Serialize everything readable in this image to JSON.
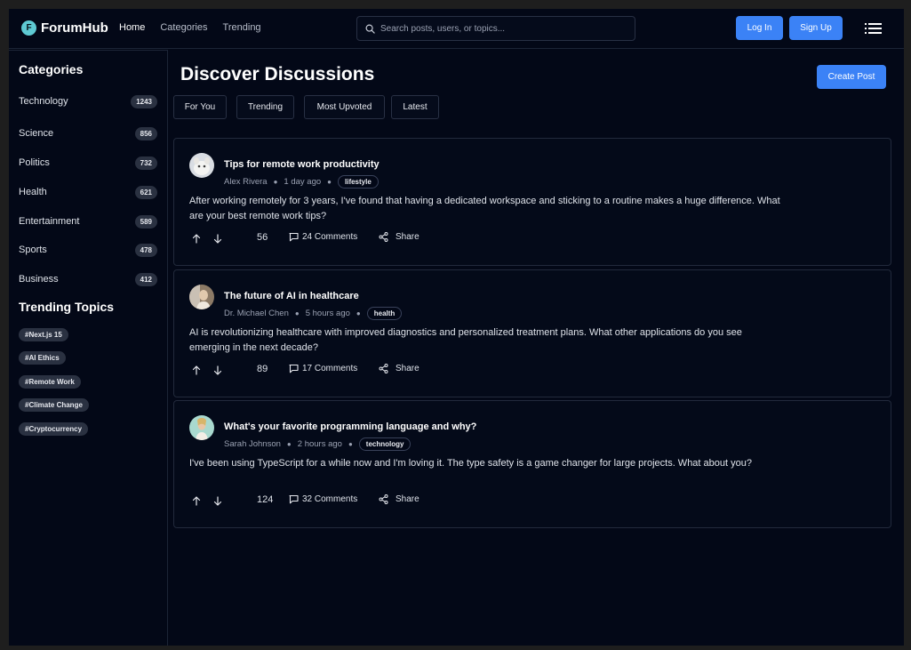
{
  "app": {
    "logo_letter": "F",
    "name": "ForumHub",
    "accent": "#3b82f6",
    "logo_color": "#5ec9d3",
    "background": "#030817"
  },
  "nav": {
    "home": "Home",
    "categories": "Categories",
    "trending": "Trending"
  },
  "search": {
    "placeholder": "Search posts, users, or topics...",
    "value": ""
  },
  "auth": {
    "login": "Log In",
    "signup": "Sign Up"
  },
  "sidebar": {
    "categories_title": "Categories",
    "categories": [
      {
        "label": "Technology",
        "count": "1243"
      },
      {
        "label": "Science",
        "count": "856"
      },
      {
        "label": "Politics",
        "count": "732"
      },
      {
        "label": "Health",
        "count": "621"
      },
      {
        "label": "Entertainment",
        "count": "589"
      },
      {
        "label": "Sports",
        "count": "478"
      },
      {
        "label": "Business",
        "count": "412"
      }
    ],
    "trending_title": "Trending Topics",
    "topics": [
      "#Next.js 15",
      "#AI Ethics",
      "#Remote Work",
      "#Climate Change",
      "#Cryptocurrency"
    ]
  },
  "main": {
    "title": "Discover Discussions",
    "create_label": "Create Post",
    "filters": [
      "For You",
      "Trending",
      "Most Upvoted",
      "Latest"
    ]
  },
  "posts": [
    {
      "title": "Tips for remote work productivity",
      "author": "Alex Rivera",
      "time": "1 day ago",
      "tag": "lifestyle",
      "body": "After working remotely for 3 years, I've found that having a dedicated workspace and sticking to a routine makes a huge difference. What are your best remote work tips?",
      "votes": "56",
      "comments": "24 Comments",
      "share": "Share",
      "avatar_bg": "#d9dde3"
    },
    {
      "title": "The future of AI in healthcare",
      "author": "Dr. Michael Chen",
      "time": "5 hours ago",
      "tag": "health",
      "body": "AI is revolutionizing healthcare with improved diagnostics and personalized treatment plans. What other applications do you see emerging in the next decade?",
      "votes": "89",
      "comments": "17 Comments",
      "share": "Share",
      "avatar_bg": "#8c7a66"
    },
    {
      "title": "What's your favorite programming language and why?",
      "author": "Sarah Johnson",
      "time": "2 hours ago",
      "tag": "technology",
      "body": "I've been using TypeScript for a while now and I'm loving it. The type safety is a game changer for large projects. What about you?",
      "votes": "124",
      "comments": "32 Comments",
      "share": "Share",
      "avatar_bg": "#a9d9cf"
    }
  ],
  "icons": {
    "search": "search-icon",
    "menu": "menu-icon",
    "upvote": "arrow-up-icon",
    "downvote": "arrow-down-icon",
    "comment": "comment-icon",
    "share": "share-icon"
  }
}
